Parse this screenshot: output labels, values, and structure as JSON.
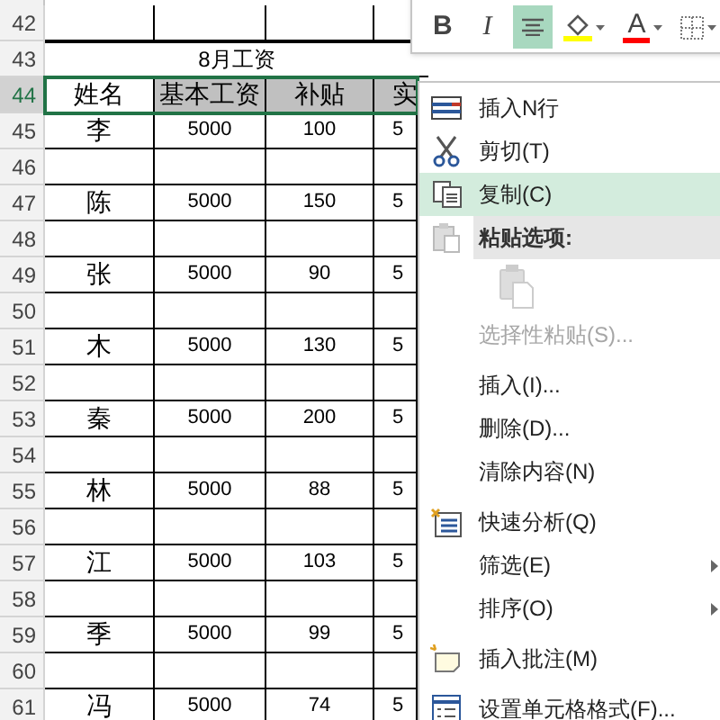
{
  "sheet": {
    "rows": [
      {
        "number": "42",
        "kind": "blank",
        "selected": false,
        "cells": []
      },
      {
        "number": "43",
        "kind": "title",
        "selected": false,
        "cells": [
          "",
          "8月工资"
        ]
      },
      {
        "number": "44",
        "kind": "header",
        "selected": true,
        "cells": [
          "姓名",
          "基本工资",
          "补贴",
          "实"
        ]
      },
      {
        "number": "45",
        "kind": "data",
        "selected": false,
        "cells": [
          "李",
          "5000",
          "100",
          "5"
        ]
      },
      {
        "number": "46",
        "kind": "blank",
        "selected": false,
        "cells": []
      },
      {
        "number": "47",
        "kind": "data",
        "selected": false,
        "cells": [
          "陈",
          "5000",
          "150",
          "5"
        ]
      },
      {
        "number": "48",
        "kind": "blank",
        "selected": false,
        "cells": []
      },
      {
        "number": "49",
        "kind": "data",
        "selected": false,
        "cells": [
          "张",
          "5000",
          "90",
          "5"
        ]
      },
      {
        "number": "50",
        "kind": "blank",
        "selected": false,
        "cells": []
      },
      {
        "number": "51",
        "kind": "data",
        "selected": false,
        "cells": [
          "木",
          "5000",
          "130",
          "5"
        ]
      },
      {
        "number": "52",
        "kind": "blank",
        "selected": false,
        "cells": []
      },
      {
        "number": "53",
        "kind": "data",
        "selected": false,
        "cells": [
          "秦",
          "5000",
          "200",
          "5"
        ]
      },
      {
        "number": "54",
        "kind": "blank",
        "selected": false,
        "cells": []
      },
      {
        "number": "55",
        "kind": "data",
        "selected": false,
        "cells": [
          "林",
          "5000",
          "88",
          "5"
        ]
      },
      {
        "number": "56",
        "kind": "blank",
        "selected": false,
        "cells": []
      },
      {
        "number": "57",
        "kind": "data",
        "selected": false,
        "cells": [
          "江",
          "5000",
          "103",
          "5"
        ]
      },
      {
        "number": "58",
        "kind": "blank",
        "selected": false,
        "cells": []
      },
      {
        "number": "59",
        "kind": "data",
        "selected": false,
        "cells": [
          "季",
          "5000",
          "99",
          "5"
        ]
      },
      {
        "number": "60",
        "kind": "blank",
        "selected": false,
        "cells": []
      },
      {
        "number": "61",
        "kind": "data",
        "selected": false,
        "cells": [
          "冯",
          "5000",
          "74",
          "5"
        ]
      }
    ]
  },
  "mini_toolbar": {
    "buttons": [
      {
        "kind": "bold",
        "label": "B",
        "selected": false
      },
      {
        "kind": "italic",
        "label": "I",
        "selected": false
      },
      {
        "kind": "align",
        "selected": true
      },
      {
        "kind": "fill",
        "color": "#ffff00",
        "selected": false
      },
      {
        "kind": "font-color",
        "label": "A",
        "color": "#ff0000",
        "selected": false
      },
      {
        "kind": "borders",
        "selected": false
      }
    ]
  },
  "context_menu": {
    "items": [
      {
        "kind": "item",
        "label": "插入N行",
        "selected": false,
        "disabled": false,
        "submenu": false
      },
      {
        "kind": "item",
        "label": "剪切(T)",
        "selected": false,
        "disabled": false,
        "submenu": false
      },
      {
        "kind": "item",
        "label": "复制(C)",
        "selected": true,
        "disabled": false,
        "submenu": false
      },
      {
        "kind": "header",
        "label": "粘贴选项:"
      },
      {
        "kind": "paste-options"
      },
      {
        "kind": "item",
        "label": "选择性粘贴(S)...",
        "selected": false,
        "disabled": true,
        "submenu": false
      },
      {
        "kind": "separator"
      },
      {
        "kind": "item",
        "label": "插入(I)...",
        "selected": false,
        "disabled": false,
        "submenu": false
      },
      {
        "kind": "item",
        "label": "删除(D)...",
        "selected": false,
        "disabled": false,
        "submenu": false
      },
      {
        "kind": "item",
        "label": "清除内容(N)",
        "selected": false,
        "disabled": false,
        "submenu": false
      },
      {
        "kind": "separator"
      },
      {
        "kind": "item",
        "label": "快速分析(Q)",
        "selected": false,
        "disabled": false,
        "submenu": false
      },
      {
        "kind": "item",
        "label": "筛选(E)",
        "selected": false,
        "disabled": false,
        "submenu": true
      },
      {
        "kind": "item",
        "label": "排序(O)",
        "selected": false,
        "disabled": false,
        "submenu": true
      },
      {
        "kind": "separator"
      },
      {
        "kind": "item",
        "label": "插入批注(M)",
        "selected": false,
        "disabled": false,
        "submenu": false
      },
      {
        "kind": "separator"
      },
      {
        "kind": "item",
        "label": "设置单元格格式(F)...",
        "selected": false,
        "disabled": false,
        "submenu": false
      }
    ]
  }
}
